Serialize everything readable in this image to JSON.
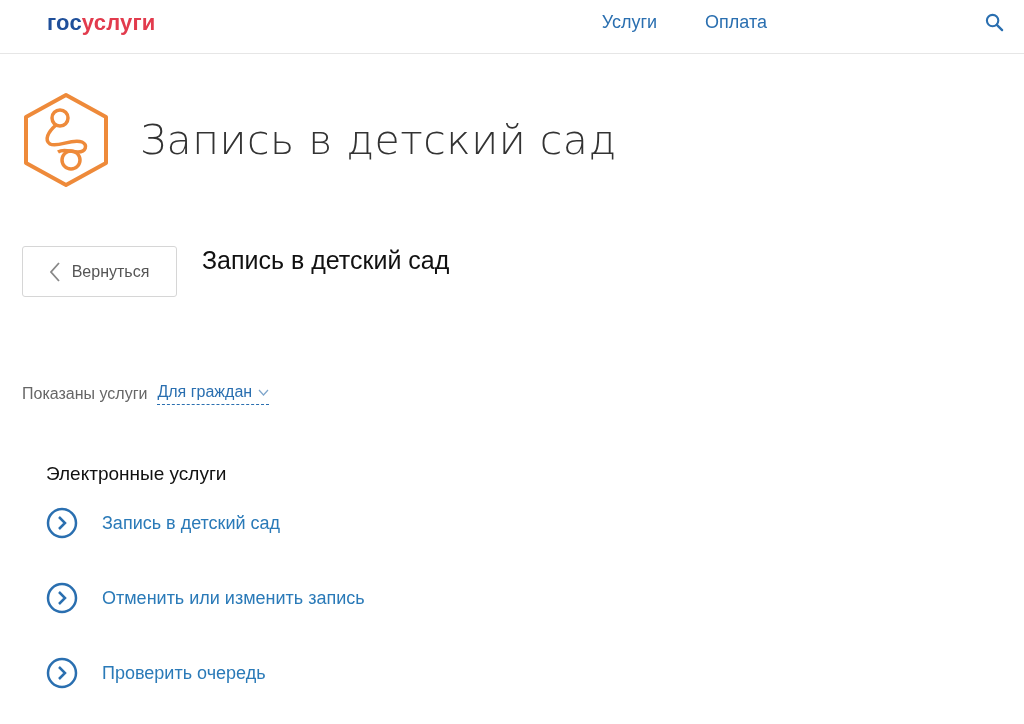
{
  "header": {
    "logo": {
      "prefix": "гос",
      "suffix": "услуги"
    },
    "nav": [
      "Услуги",
      "Оплата"
    ]
  },
  "page_title": "Запись в детский сад",
  "back_button": "Вернуться",
  "subtitle": "Запись в детский сад",
  "filter": {
    "label": "Показаны услуги",
    "value": "Для граждан"
  },
  "section": {
    "title": "Электронные услуги",
    "links": [
      "Запись в детский сад",
      "Отменить или изменить запись",
      "Проверить очередь"
    ]
  }
}
